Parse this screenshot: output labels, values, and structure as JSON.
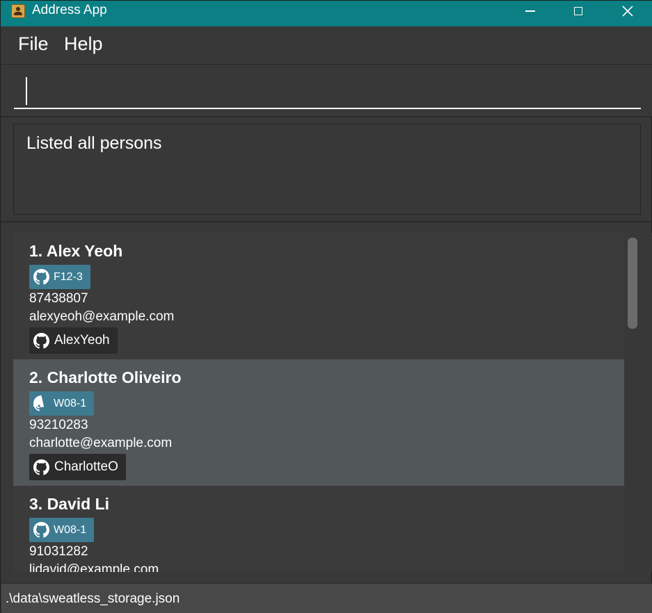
{
  "window": {
    "title": "Address App",
    "icon": "address-book-icon"
  },
  "menu": {
    "items": [
      {
        "label": "File"
      },
      {
        "label": "Help"
      }
    ]
  },
  "command_box": {
    "value": ""
  },
  "result_display": {
    "text": "Listed all persons"
  },
  "persons": [
    {
      "name": "1. Alex Yeoh",
      "tag": "F12-3",
      "phone": "87438807",
      "email": "alexyeoh@example.com",
      "github": "AlexYeoh"
    },
    {
      "name": "2. Charlotte Oliveiro",
      "tag": "W08-1",
      "phone": "93210283",
      "email": "charlotte@example.com",
      "github": "CharlotteO"
    },
    {
      "name": "3. David Li",
      "tag": "W08-1",
      "phone": "91031282",
      "email": "lidavid@example.com",
      "github": ""
    }
  ],
  "status_bar": {
    "save_location": ".\\data\\sweatless_storage.json"
  },
  "colors": {
    "title_bar": "#0a7f84",
    "background": "#383838",
    "tag": "#3e7b91",
    "selected_card": "#525759"
  }
}
